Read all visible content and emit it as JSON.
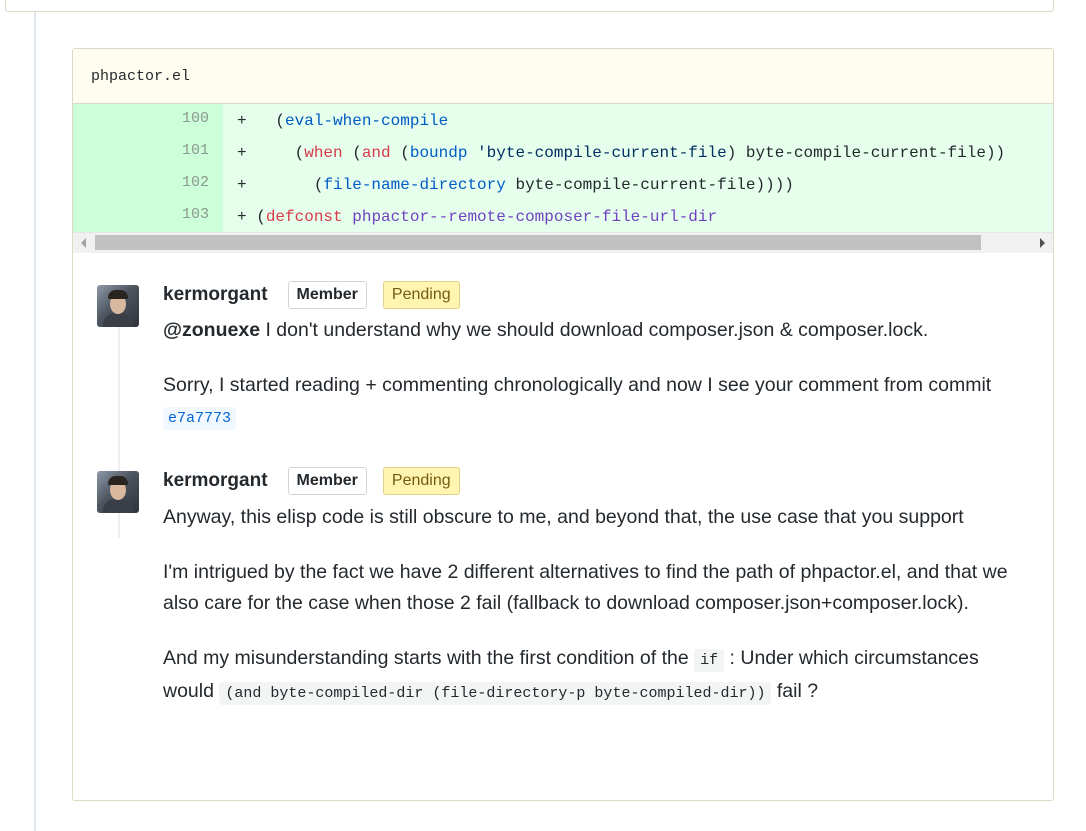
{
  "file": {
    "name": "phpactor.el"
  },
  "diff": {
    "lines": [
      {
        "num": "100",
        "marker": "+",
        "indent": "  ",
        "tokens": [
          {
            "t": "(",
            "c": ""
          },
          {
            "t": "eval-when-compile",
            "c": "fn"
          }
        ]
      },
      {
        "num": "101",
        "marker": "+",
        "indent": "    ",
        "tokens": [
          {
            "t": "(",
            "c": ""
          },
          {
            "t": "when",
            "c": "kw"
          },
          {
            "t": " (",
            "c": ""
          },
          {
            "t": "and",
            "c": "kw"
          },
          {
            "t": " (",
            "c": ""
          },
          {
            "t": "boundp",
            "c": "fn"
          },
          {
            "t": " 'byte-compile-current-file",
            "c": "str"
          },
          {
            "t": ") byte-compile-current-file))",
            "c": ""
          }
        ]
      },
      {
        "num": "102",
        "marker": "+",
        "indent": "      ",
        "tokens": [
          {
            "t": "(",
            "c": ""
          },
          {
            "t": "file-name-directory",
            "c": "fn"
          },
          {
            "t": " byte-compile-current-file))))",
            "c": ""
          }
        ]
      },
      {
        "num": "103",
        "marker": "+",
        "indent": "",
        "tokens": [
          {
            "t": "(",
            "c": ""
          },
          {
            "t": "defconst",
            "c": "kw"
          },
          {
            "t": " ",
            "c": ""
          },
          {
            "t": "phpactor--remote-composer-file-url-dir",
            "c": "nm"
          }
        ]
      }
    ]
  },
  "comments": [
    {
      "author": "kermorgant",
      "role": "Member",
      "status": "Pending",
      "mention": "@zonuexe",
      "p1_rest": " I don't understand why we should download composer.json & composer.lock.",
      "p2_text": "Sorry, I started reading + commenting chronologically and now I see your comment from commit ",
      "p2_sha": "e7a7773"
    },
    {
      "author": "kermorgant",
      "role": "Member",
      "status": "Pending",
      "p1": "Anyway, this elisp code is still obscure to me, and beyond that, the use case that you support",
      "p2": "I'm intrigued by the fact we have 2 different alternatives to find the path of phpactor.el, and that we also care for the case when those 2 fail (fallback to download composer.json+composer.lock).",
      "p3_a": "And my misunderstanding starts with the first condition of the ",
      "p3_code1": "if",
      "p3_b": " : Under which circumstances would ",
      "p3_code2": "(and byte-compiled-dir (file-directory-p byte-compiled-dir))",
      "p3_c": " fail ?"
    }
  ],
  "colors": {
    "added_bg": "#e6ffed",
    "added_gutter": "#cdffd8",
    "pending_bg": "#fff5b1",
    "link": "#0366d6"
  },
  "icons": [
    "scroll-left-icon",
    "scroll-right-icon",
    "avatar"
  ]
}
